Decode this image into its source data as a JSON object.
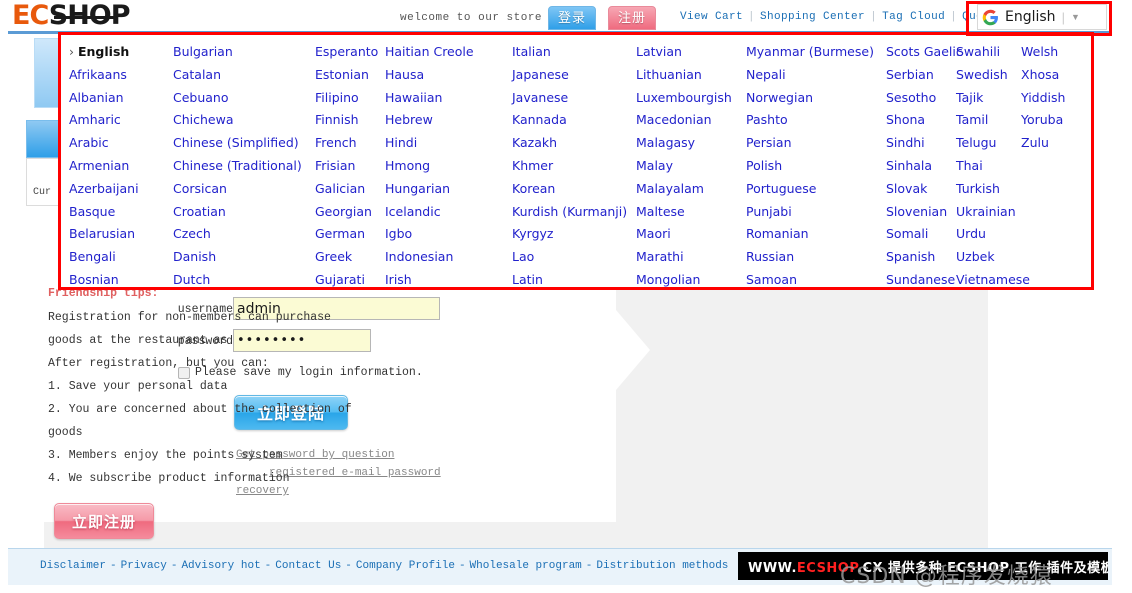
{
  "header": {
    "logo_ec": "EC",
    "logo_shop": "SHOP",
    "welcome": "welcome to our store",
    "tab_login": "登录",
    "tab_register": "注册",
    "nav": [
      {
        "label": "View Cart"
      },
      {
        "label": "Shopping Center"
      },
      {
        "label": "Tag Cloud"
      },
      {
        "label": "Quote"
      }
    ],
    "nav_separator": "|",
    "translate": {
      "icon": "google-g-icon",
      "current_language": "English",
      "divider": "|",
      "caret": "▼"
    }
  },
  "sidebar": {
    "label": "Cur"
  },
  "language_menu": {
    "current": "English",
    "columns": [
      [
        "English",
        "Afrikaans",
        "Albanian",
        "Amharic",
        "Arabic",
        "Armenian",
        "Azerbaijani",
        "Basque",
        "Belarusian",
        "Bengali",
        "Bosnian"
      ],
      [
        "Bulgarian",
        "Catalan",
        "Cebuano",
        "Chichewa",
        "Chinese (Simplified)",
        "Chinese (Traditional)",
        "Corsican",
        "Croatian",
        "Czech",
        "Danish",
        "Dutch"
      ],
      [
        "Esperanto",
        "Estonian",
        "Filipino",
        "Finnish",
        "French",
        "Frisian",
        "Galician",
        "Georgian",
        "German",
        "Greek",
        "Gujarati"
      ],
      [
        "Haitian Creole",
        "Hausa",
        "Hawaiian",
        "Hebrew",
        "Hindi",
        "Hmong",
        "Hungarian",
        "Icelandic",
        "Igbo",
        "Indonesian",
        "Irish"
      ],
      [
        "Italian",
        "Japanese",
        "Javanese",
        "Kannada",
        "Kazakh",
        "Khmer",
        "Korean",
        "Kurdish (Kurmanji)",
        "Kyrgyz",
        "Lao",
        "Latin"
      ],
      [
        "Latvian",
        "Lithuanian",
        "Luxembourgish",
        "Macedonian",
        "Malagasy",
        "Malay",
        "Malayalam",
        "Maltese",
        "Maori",
        "Marathi",
        "Mongolian"
      ],
      [
        "Myanmar (Burmese)",
        "Nepali",
        "Norwegian",
        "Pashto",
        "Persian",
        "Polish",
        "Portuguese",
        "Punjabi",
        "Romanian",
        "Russian",
        "Samoan"
      ],
      [
        "Scots Gaelic",
        "Serbian",
        "Sesotho",
        "Shona",
        "Sindhi",
        "Sinhala",
        "Slovak",
        "Slovenian",
        "Somali",
        "Spanish",
        "Sundanese"
      ],
      [
        "Swahili",
        "Swedish",
        "Tajik",
        "Tamil",
        "Telugu",
        "Thai",
        "Turkish",
        "Ukrainian",
        "Urdu",
        "Uzbek",
        "Vietnamese"
      ],
      [
        "Welsh",
        "Xhosa",
        "Yiddish",
        "Yoruba",
        "Zulu"
      ]
    ]
  },
  "login_form": {
    "username_label": "username",
    "username_value": "admin",
    "username_placeholder": "",
    "password_label": "password",
    "password_value": "••••••••",
    "password_placeholder": "",
    "remember_label": "Please save my login information.",
    "submit_label": "立即登陆",
    "help_links": [
      "Get password by question",
      "registered e-mail password",
      "recovery"
    ]
  },
  "info_panel": {
    "title": "Friendship tips:",
    "lines": [
      "Registration for non-members can purchase",
      "goods at the restaurant as",
      "After registration, but you can:",
      "1. Save your personal data",
      "2. You are concerned about the collection of",
      "goods",
      "3. Members enjoy the points system",
      "4. We subscribe product information"
    ],
    "register_label": "立即注册"
  },
  "footer": {
    "links": [
      "Disclaimer",
      "Privacy",
      "Advisory hot",
      "Contact Us",
      "Company Profile",
      "Wholesale program",
      "Distribution methods"
    ],
    "separator": "-",
    "banner": {
      "prefix": "WWW.",
      "brand": "ECSHOP",
      "suffix": ".CX",
      "chinese": "提供多种 ECSHOP 工作 插件及模板"
    },
    "watermark": "CSDN @程序发烧猿"
  },
  "colors": {
    "annotation": "#ff0000",
    "link_blue": "#1b6fb5",
    "language_blue": "#2222cc",
    "login_button": "#2aa5e8",
    "register_button": "#ef6b7f",
    "input_autofill": "#fbfbd4"
  }
}
